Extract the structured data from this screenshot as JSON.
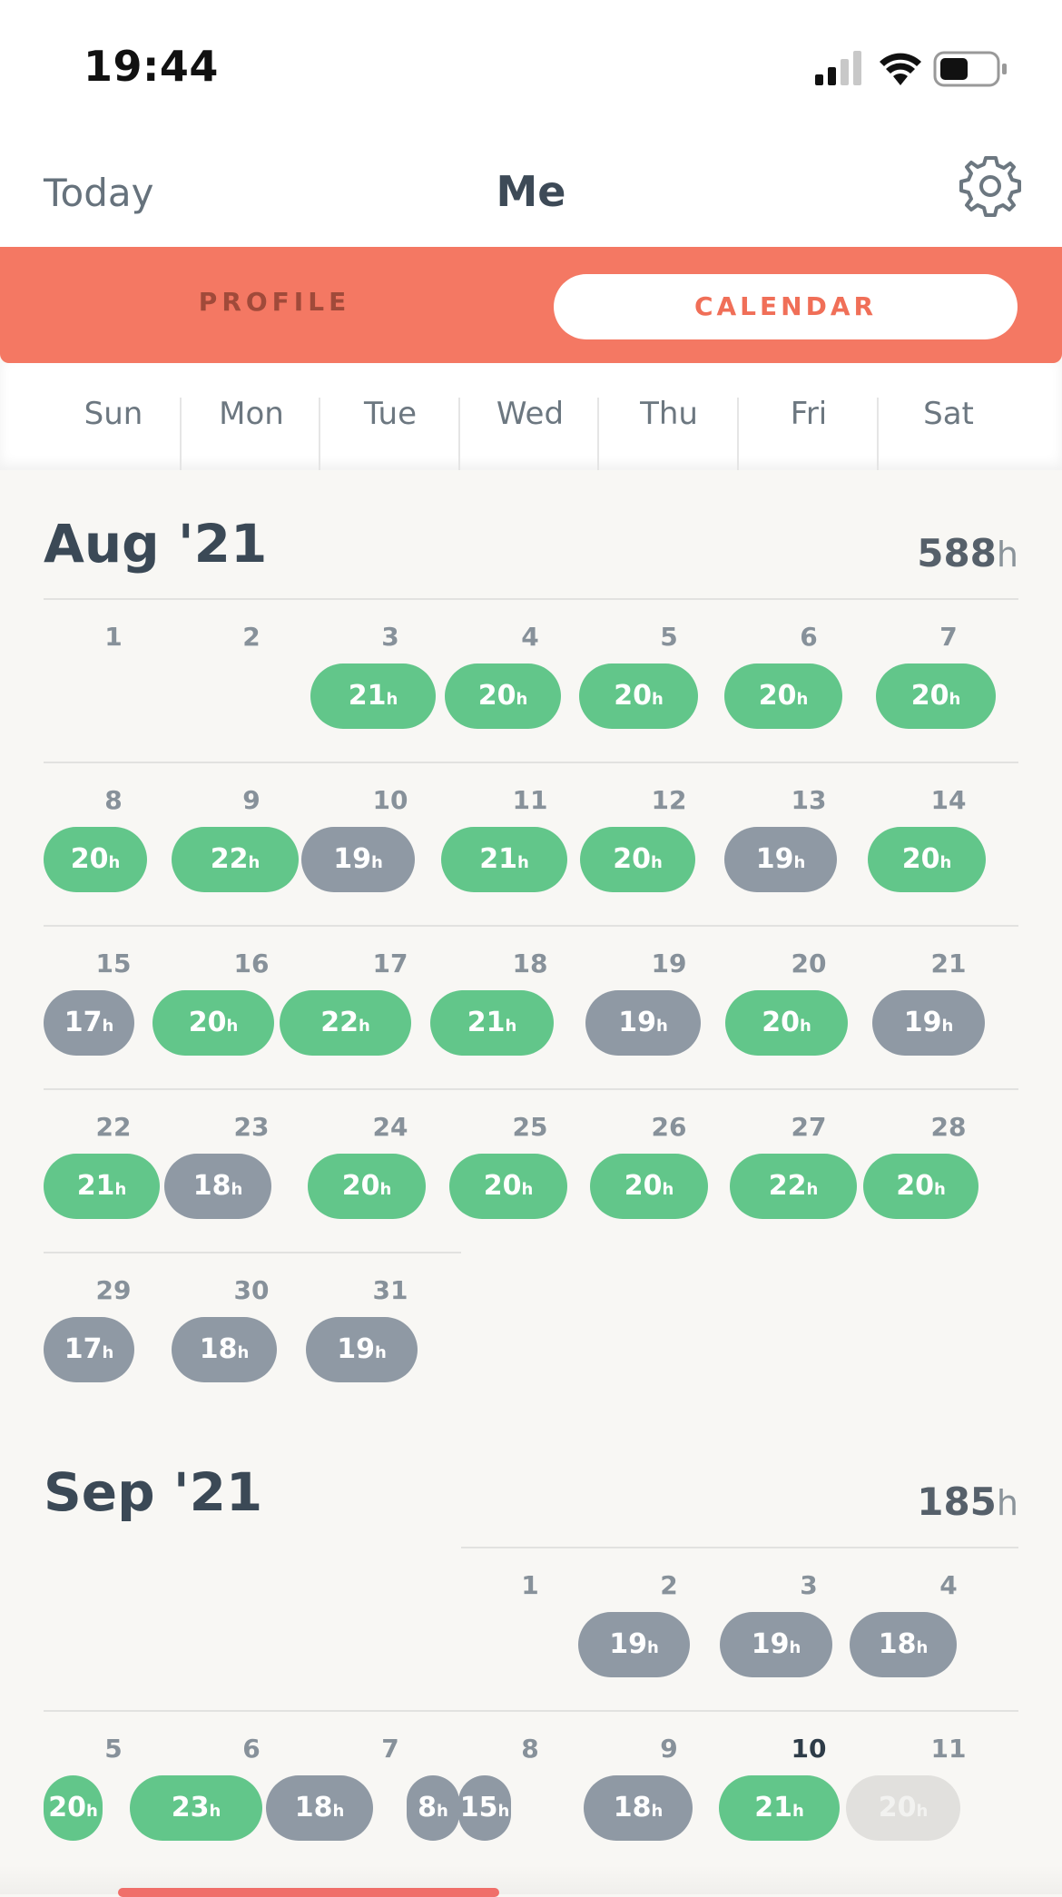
{
  "status_bar": {
    "time": "19:44"
  },
  "nav": {
    "left": "Today",
    "title": "Me",
    "settings_icon": "gear-icon"
  },
  "tabs": {
    "profile": "PROFILE",
    "calendar": "CALENDAR",
    "selected": "calendar"
  },
  "weekdays": [
    "Sun",
    "Mon",
    "Tue",
    "Wed",
    "Thu",
    "Fri",
    "Sat"
  ],
  "colors": {
    "accent": "#f47863",
    "met_goal": "#62c68a",
    "below_goal": "#8f99a4",
    "future": "#e1e0dd"
  },
  "hour_unit": "h",
  "months": [
    {
      "title": "Aug '21",
      "total": "588",
      "total_unit": "h",
      "days": [
        {
          "d": "1"
        },
        {
          "d": "2"
        },
        {
          "d": "3",
          "h": "21",
          "c": "g"
        },
        {
          "d": "4",
          "h": "20",
          "c": "g"
        },
        {
          "d": "5",
          "h": "20",
          "c": "g"
        },
        {
          "d": "6",
          "h": "20",
          "c": "g"
        },
        {
          "d": "7",
          "h": "20",
          "c": "g"
        },
        {
          "d": "8",
          "h": "20",
          "c": "g"
        },
        {
          "d": "9",
          "h": "22",
          "c": "g"
        },
        {
          "d": "10",
          "h": "19",
          "c": "s"
        },
        {
          "d": "11",
          "h": "21",
          "c": "g"
        },
        {
          "d": "12",
          "h": "20",
          "c": "g"
        },
        {
          "d": "13",
          "h": "19",
          "c": "s"
        },
        {
          "d": "14",
          "h": "20",
          "c": "g"
        },
        {
          "d": "15",
          "h": "17",
          "c": "s"
        },
        {
          "d": "16",
          "h": "20",
          "c": "g"
        },
        {
          "d": "17",
          "h": "22",
          "c": "g"
        },
        {
          "d": "18",
          "h": "21",
          "c": "g"
        },
        {
          "d": "19",
          "h": "19",
          "c": "s"
        },
        {
          "d": "20",
          "h": "20",
          "c": "g"
        },
        {
          "d": "21",
          "h": "19",
          "c": "s"
        },
        {
          "d": "22",
          "h": "21",
          "c": "g"
        },
        {
          "d": "23",
          "h": "18",
          "c": "s"
        },
        {
          "d": "24",
          "h": "20",
          "c": "g"
        },
        {
          "d": "25",
          "h": "20",
          "c": "g"
        },
        {
          "d": "26",
          "h": "20",
          "c": "g"
        },
        {
          "d": "27",
          "h": "22",
          "c": "g"
        },
        {
          "d": "28",
          "h": "20",
          "c": "g"
        },
        {
          "d": "29",
          "h": "17",
          "c": "s"
        },
        {
          "d": "30",
          "h": "18",
          "c": "s"
        },
        {
          "d": "31",
          "h": "19",
          "c": "s"
        }
      ]
    },
    {
      "title": "Sep '21",
      "total": "185",
      "total_unit": "h",
      "days": [
        {
          "d": "1"
        },
        {
          "d": "2",
          "h": "19",
          "c": "s"
        },
        {
          "d": "3",
          "h": "19",
          "c": "s"
        },
        {
          "d": "4",
          "h": "18",
          "c": "s"
        },
        {
          "d": "5",
          "h": "20",
          "c": "g"
        },
        {
          "d": "6",
          "h": "23",
          "c": "g"
        },
        {
          "d": "7",
          "h": "18",
          "c": "s"
        },
        {
          "d": "8",
          "h": "8",
          "c": "s"
        },
        {
          "d": "9",
          "h": "15",
          "c": "s"
        },
        {
          "d": "10",
          "h": "18",
          "c": "s",
          "today": true
        },
        {
          "d": "11",
          "h": "21",
          "c": "g"
        },
        {
          "d": "11b",
          "h": "20",
          "c": "l"
        }
      ]
    }
  ]
}
